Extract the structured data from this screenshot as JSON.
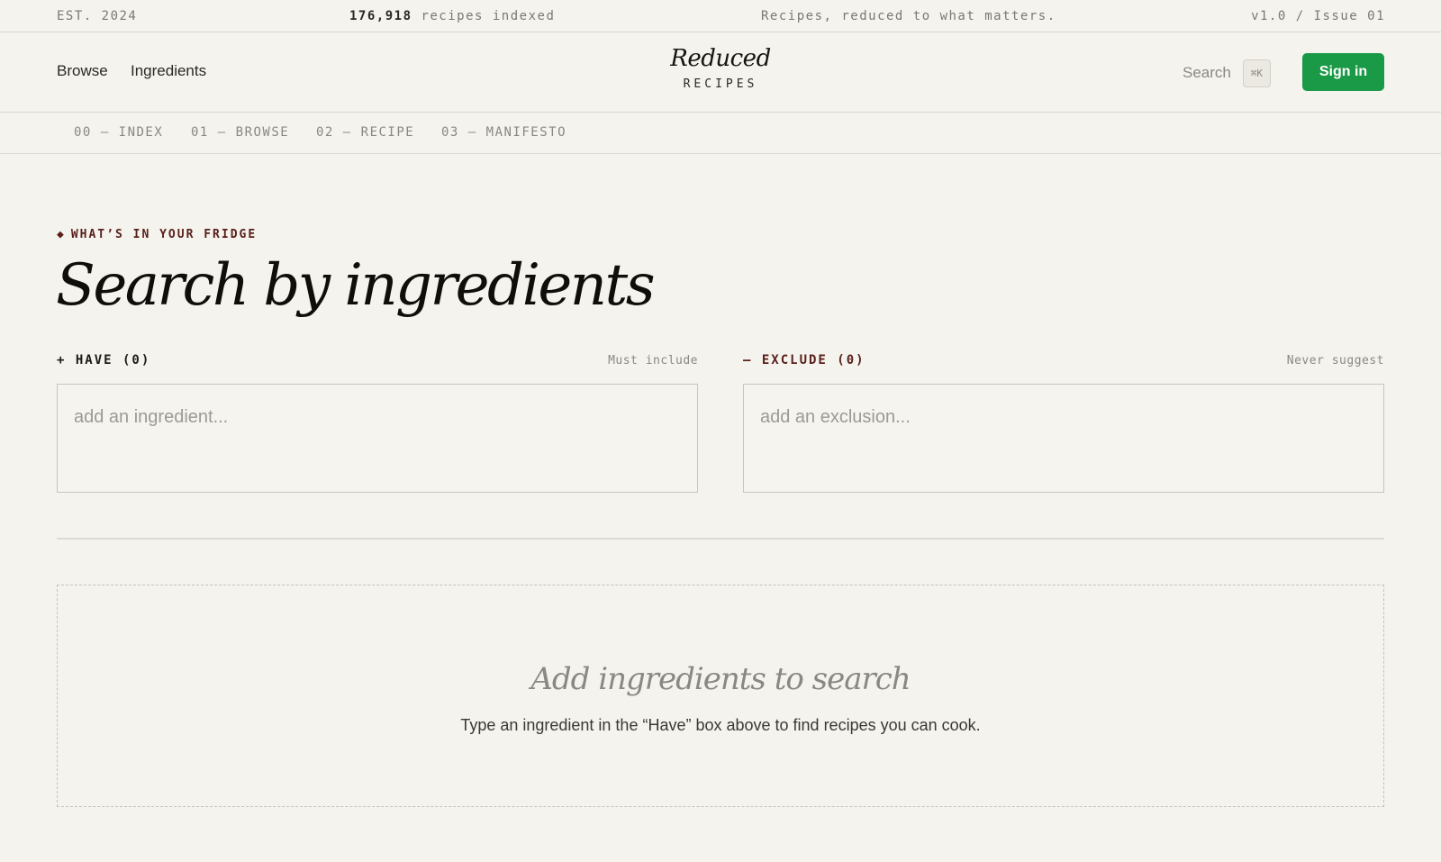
{
  "topbar": {
    "est": "EST. 2024",
    "count_value": "176,918",
    "count_suffix": " recipes indexed",
    "tagline": "Recipes, reduced to what matters.",
    "version": "v1.0 / Issue 01"
  },
  "header": {
    "nav": [
      {
        "label": "Browse"
      },
      {
        "label": "Ingredients"
      }
    ],
    "logo_title": "Reduced",
    "logo_sub": "RECIPES",
    "search_label": "Search",
    "search_shortcut": "⌘K",
    "signin_label": "Sign in",
    "signin_color": "#1a9a46"
  },
  "subnav": [
    {
      "label": "00 — INDEX"
    },
    {
      "label": "01 — BROWSE"
    },
    {
      "label": "02 — RECIPE"
    },
    {
      "label": "03 — MANIFESTO"
    }
  ],
  "main": {
    "eyebrow_icon": "◆",
    "eyebrow": "WHAT’S IN YOUR FRIDGE",
    "title": "Search by ingredients",
    "have": {
      "label": "+ HAVE (0)",
      "hint": "Must include",
      "placeholder": "add an ingredient...",
      "value": ""
    },
    "exclude": {
      "label": "— EXCLUDE (0)",
      "hint": "Never suggest",
      "placeholder": "add an exclusion...",
      "value": ""
    },
    "empty": {
      "title": "Add ingredients to search",
      "text": "Type an ingredient in the “Have” box above to find recipes you can cook."
    }
  },
  "colors": {
    "background": "#f4f3ee",
    "accent_dark_red": "#5a1f1a",
    "primary_green": "#1a9a46"
  }
}
